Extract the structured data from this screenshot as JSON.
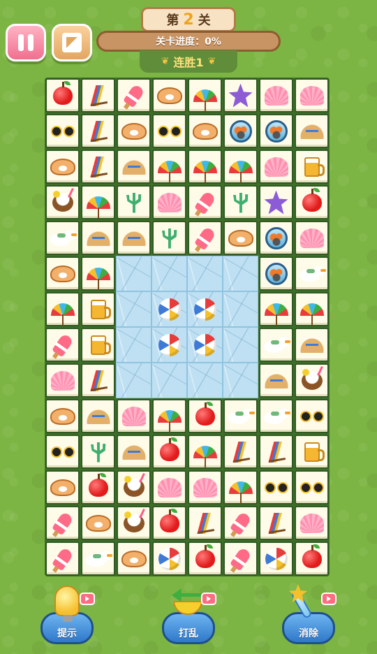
{
  "header": {
    "level_prefix": "第",
    "level_number": "2",
    "level_suffix": "关",
    "progress_text": "关卡进度：0%",
    "progress_value": 0,
    "streak_text": "连胜1"
  },
  "buttons": {
    "pause": "pause-icon",
    "menu": "menu-icon"
  },
  "board": {
    "cols": 8,
    "rows": [
      [
        "apple",
        "chair",
        "popsicle",
        "oyster",
        "umbrella",
        "star",
        "shell",
        "shell"
      ],
      [
        "glasses",
        "chair",
        "oyster",
        "glasses",
        "oyster",
        "aquarium",
        "aquarium",
        "hat"
      ],
      [
        "oyster",
        "chair",
        "hat",
        "umbrella",
        "umbrella",
        "umbrella",
        "shell",
        "beer"
      ],
      [
        "coconut",
        "umbrella",
        "coral",
        "shell",
        "popsicle",
        "coral",
        "star",
        "apple"
      ],
      [
        "bird",
        "hat",
        "hat",
        "coral",
        "popsicle",
        "oyster",
        "aquarium",
        "shell"
      ],
      [
        "oyster",
        "umbrella",
        "ice",
        "ice",
        "ice",
        "ice",
        "aquarium",
        "bird"
      ],
      [
        "umbrella",
        "beer",
        "ice",
        "ice-ball",
        "ice-ball",
        "ice",
        "umbrella",
        "umbrella"
      ],
      [
        "popsicle",
        "beer",
        "ice",
        "ice-ball",
        "ice-ball",
        "ice",
        "bird",
        "hat"
      ],
      [
        "shell",
        "chair",
        "ice",
        "ice",
        "ice",
        "ice",
        "hat",
        "coconut"
      ],
      [
        "oyster",
        "hat",
        "shell",
        "umbrella",
        "apple",
        "bird",
        "bird",
        "glasses"
      ],
      [
        "glasses",
        "coral",
        "hat",
        "apple",
        "umbrella",
        "chair",
        "chair",
        "beer"
      ],
      [
        "oyster",
        "apple",
        "coconut",
        "shell",
        "shell",
        "umbrella",
        "glasses",
        "glasses"
      ],
      [
        "popsicle",
        "oyster",
        "coconut",
        "apple",
        "chair",
        "popsicle",
        "chair",
        "shell"
      ],
      [
        "popsicle",
        "bird",
        "oyster",
        "ball",
        "apple",
        "popsicle",
        "ball",
        "apple"
      ]
    ]
  },
  "tools": {
    "hint_label": "提示",
    "shuffle_label": "打乱",
    "remove_label": "消除"
  }
}
